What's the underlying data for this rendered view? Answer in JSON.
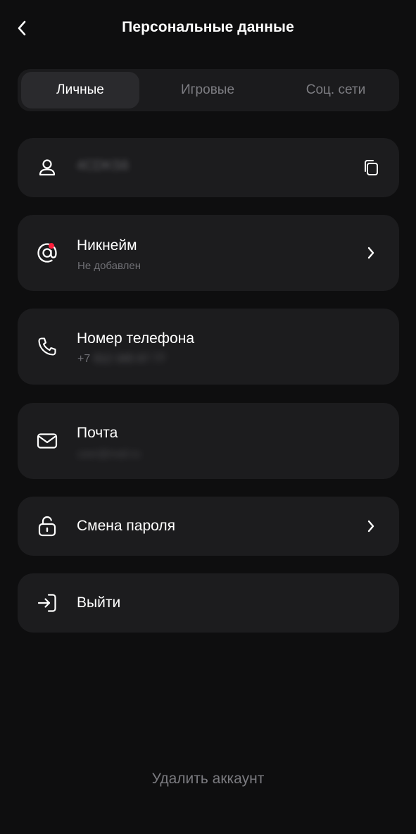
{
  "header": {
    "title": "Персональные данные",
    "back_icon": "chevron-left-icon"
  },
  "tabs": [
    {
      "label": "Личные",
      "active": true
    },
    {
      "label": "Игровые",
      "active": false
    },
    {
      "label": "Соц. сети",
      "active": false
    }
  ],
  "items": {
    "user_id": {
      "icon": "user-icon",
      "value": "4CDKS6",
      "value_blurred": true,
      "action_icon": "copy-icon"
    },
    "nickname": {
      "icon": "at-sign-icon",
      "title": "Никнейм",
      "subtitle": "Не добавлен",
      "has_badge": true,
      "badge_color": "#ff1f3d"
    },
    "phone": {
      "icon": "phone-icon",
      "title": "Номер телефона",
      "subtitle_prefix": "+7",
      "subtitle_hidden": "912 345 67 77",
      "subtitle_blurred": true
    },
    "email": {
      "icon": "mail-icon",
      "title": "Почта",
      "subtitle_hidden": "user@mail.ru",
      "subtitle_blurred": true
    },
    "password": {
      "icon": "unlock-icon",
      "title": "Смена пароля"
    },
    "logout": {
      "icon": "sign-in-icon",
      "title": "Выйти"
    }
  },
  "footer": {
    "delete_label": "Удалить аккаунт"
  },
  "colors": {
    "background": "#0e0e0f",
    "card": "#1c1c1e",
    "accent_red": "#ff1f3d",
    "muted_text": "#6f6f74"
  }
}
